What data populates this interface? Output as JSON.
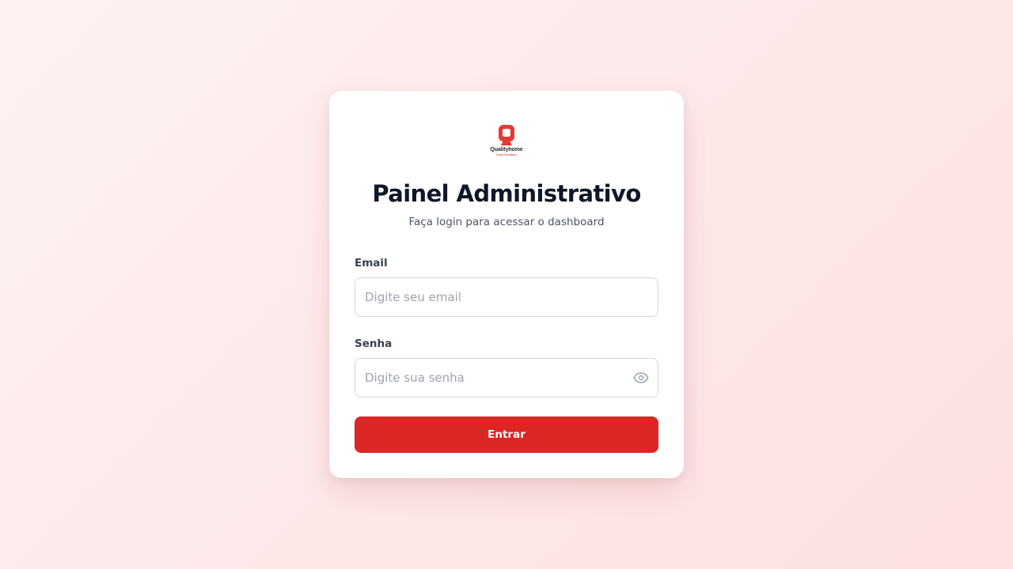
{
  "brand": {
    "name": "Qualityhome",
    "tagline": "Portal Imobiliário",
    "logo_icon": "q-logo-icon",
    "accent_color": "#dc2626"
  },
  "header": {
    "title": "Painel Administrativo",
    "subtitle": "Faça login para acessar o dashboard"
  },
  "form": {
    "email": {
      "label": "Email",
      "value": "",
      "placeholder": "Digite seu email"
    },
    "password": {
      "label": "Senha",
      "value": "",
      "placeholder": "Digite sua senha",
      "toggle_icon": "eye-icon"
    },
    "submit_label": "Entrar"
  }
}
